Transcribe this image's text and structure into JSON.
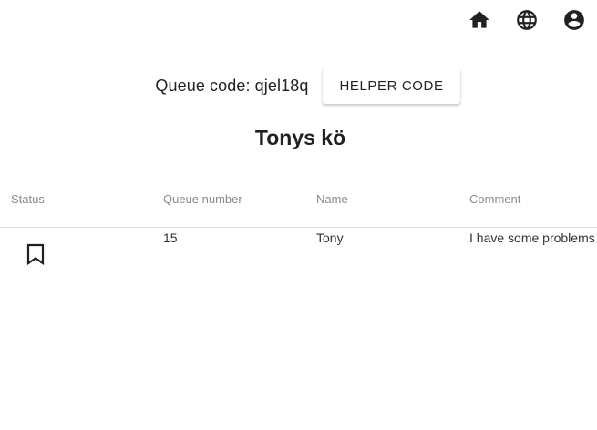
{
  "nav": {
    "icons": [
      "home-icon",
      "globe-icon",
      "account-circle-icon"
    ]
  },
  "queue": {
    "code_text": "Queue code: qjel18q",
    "helper_button_label": "HELPER CODE",
    "title": "Tonys kö"
  },
  "table": {
    "headers": {
      "status": "Status",
      "queue_number": "Queue number",
      "name": "Name",
      "comment": "Comment"
    },
    "rows": [
      {
        "status_icon": "bookmark-outline-icon",
        "queue_number": "15",
        "name": "Tony",
        "comment": "I have some problems"
      }
    ]
  },
  "colors": {
    "text": "#212121",
    "header_text": "#8a8a8a",
    "divider": "#e0e0e0"
  }
}
